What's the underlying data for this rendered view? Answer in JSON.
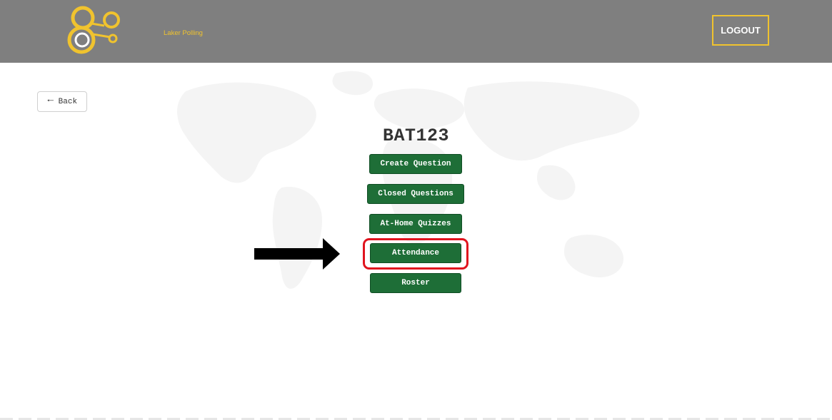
{
  "header": {
    "logo_text": "Laker Polling",
    "logout_label": "LOGOUT"
  },
  "back_button": {
    "label": "Back"
  },
  "course": {
    "title": "BAT123"
  },
  "menu": {
    "create_question": "Create Question",
    "closed_questions": "Closed Questions",
    "at_home_quizzes": "At-Home Quizzes",
    "attendance": "Attendance",
    "roster": "Roster"
  },
  "colors": {
    "header_bg": "#7f7f7f",
    "accent_yellow": "#f0c32e",
    "button_green": "#1e6e37",
    "highlight_red": "#e0141e"
  }
}
